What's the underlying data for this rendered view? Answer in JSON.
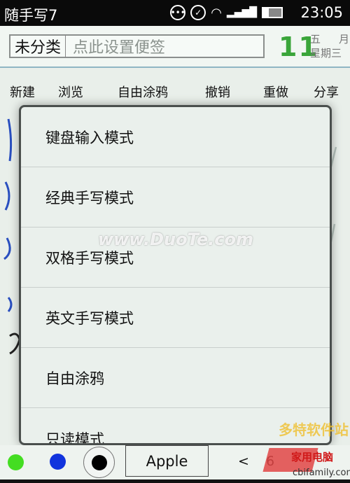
{
  "status_bar": {
    "app_title": "随手写7",
    "time": "23:05",
    "icons": [
      "more-icon",
      "check-circle-icon",
      "wifi-icon",
      "signal-icon",
      "battery-icon"
    ]
  },
  "header": {
    "category": "未分类",
    "placeholder": "点此设置便签",
    "day": "11",
    "month_num": "五",
    "month_label": "月",
    "weekday": "星期三"
  },
  "toolbar": {
    "items": [
      "新建",
      "浏览",
      "自由涂鸦",
      "撤销",
      "重做",
      "分享"
    ]
  },
  "menu": {
    "items": [
      "键盘输入模式",
      "经典手写模式",
      "双格手写模式",
      "英文手写模式",
      "自由涂鸦",
      "只读模式"
    ]
  },
  "watermark": "www.DuoTe.com",
  "bottom": {
    "colors": [
      "#44dd22",
      "#1133dd",
      "#000000"
    ],
    "font": "Apple",
    "pager_prev": "<",
    "page": "6"
  },
  "logos": {
    "duote": "多特软件站",
    "cbifamily": "家用电脑",
    "site": "cbifamily.com"
  }
}
